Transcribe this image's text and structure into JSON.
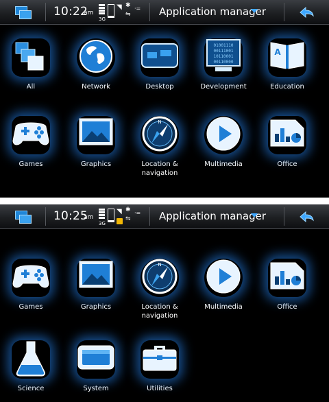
{
  "screens": [
    {
      "clock": "10:22",
      "ampm": "am",
      "network": "3G",
      "title": "Application manager"
    },
    {
      "clock": "10:25",
      "ampm": "am",
      "network": "3G",
      "title": "Application manager"
    }
  ],
  "categories": {
    "all": "All",
    "network": "Network",
    "desktop": "Desktop",
    "development": "Development",
    "education": "Education",
    "games": "Games",
    "graphics": "Graphics",
    "location": "Location & navigation",
    "multimedia": "Multimedia",
    "office": "Office",
    "science": "Science",
    "system": "System",
    "utilities": "Utilities"
  },
  "icons": {
    "all": "stacked-windows-icon",
    "network": "globe-icon",
    "desktop": "desktop-widgets-icon",
    "development": "binary-monitor-icon",
    "education": "book-icon",
    "games": "gamepad-icon",
    "graphics": "picture-icon",
    "location": "compass-icon",
    "multimedia": "play-icon",
    "office": "chart-document-icon",
    "science": "flask-icon",
    "system": "device-icon",
    "utilities": "toolbox-icon"
  },
  "dev_icon_text": [
    "01001110",
    "00111001",
    "10110001",
    "00110000"
  ],
  "edu_icon_letter": "A",
  "compass_letter": "N",
  "colors": {
    "accent": "#3ea7ff",
    "glow": "#1f86d8",
    "background": "#000000"
  }
}
